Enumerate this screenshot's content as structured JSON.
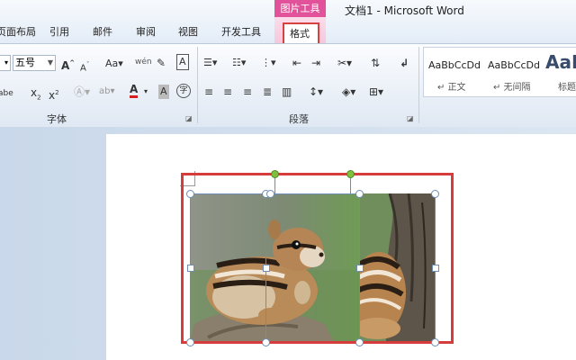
{
  "window": {
    "title": "文档1 - Microsoft Word",
    "contextual_group": "图片工具"
  },
  "tabs": [
    {
      "label": "页面布局"
    },
    {
      "label": "引用"
    },
    {
      "label": "邮件"
    },
    {
      "label": "审阅"
    },
    {
      "label": "视图"
    },
    {
      "label": "开发工具"
    },
    {
      "label": "格式",
      "selected": true,
      "highlighted": true
    }
  ],
  "ribbon": {
    "font_group": {
      "label": "字体",
      "font_size": "五号",
      "grow_font": "A",
      "shrink_font": "A",
      "change_case": "Aa",
      "phonetic": "wén",
      "char_border": "A",
      "subscript": "x",
      "superscript": "x",
      "font_color": "A",
      "char_shading": "A",
      "enclose": "字"
    },
    "paragraph_group": {
      "label": "段落"
    },
    "styles_group": {
      "samples": [
        "AaBbCcDd",
        "AaBbCcDd",
        "AaB"
      ],
      "names": [
        "↵ 正文",
        "↵ 无间隔",
        "标题"
      ]
    }
  },
  "colors": {
    "contextual_pink": "#e1529a",
    "highlight_red": "#d63c3c",
    "selection_blue": "#6e8db5"
  },
  "document": {
    "images": [
      {
        "name": "chipmunk-photo-left",
        "description": "chipmunk on rock"
      },
      {
        "name": "chipmunk-photo-right",
        "description": "chipmunk on tree trunk"
      }
    ]
  }
}
